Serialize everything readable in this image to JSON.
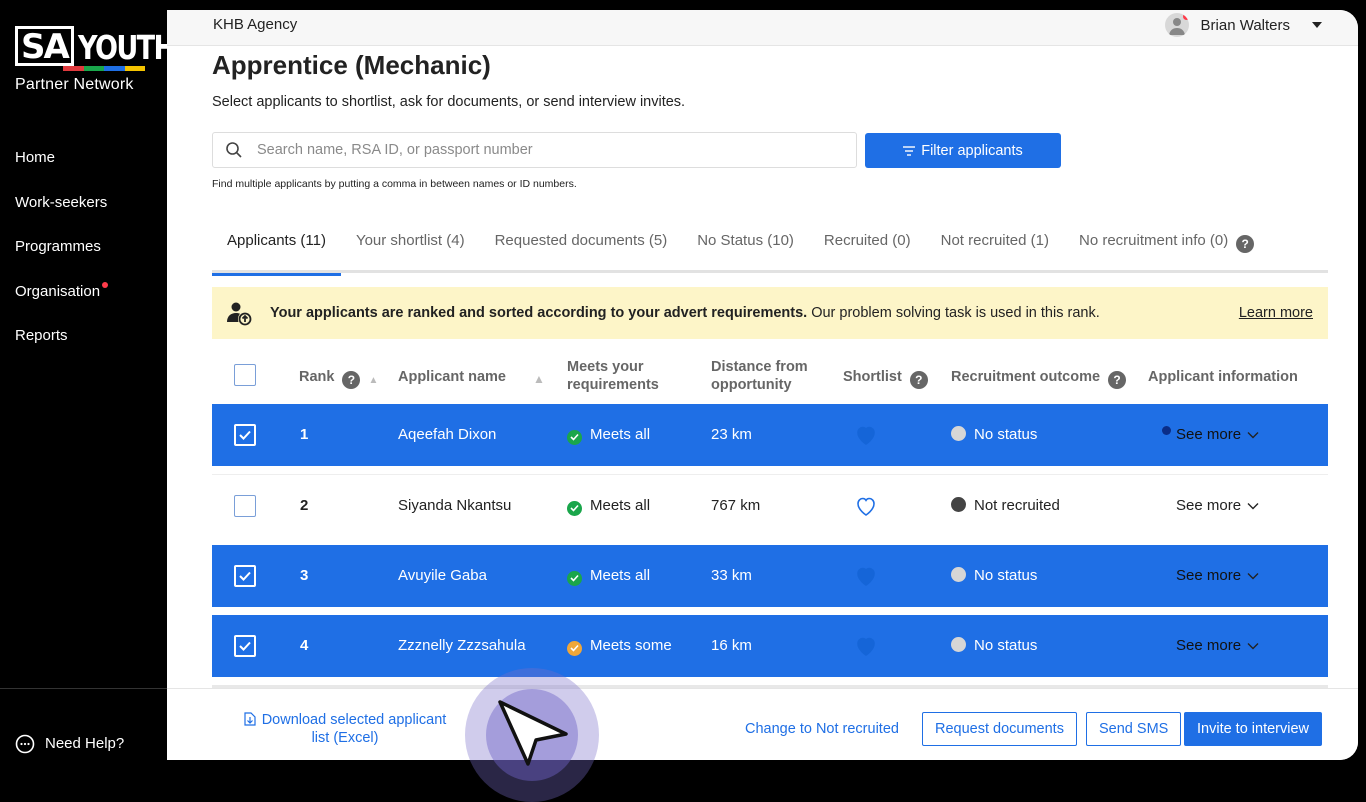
{
  "brand": {
    "logo_left": "SA",
    "logo_right": "YOUTH",
    "tagline": "Partner Network",
    "stripe_colors": [
      "#e03a3e",
      "#1aa64b",
      "#1f6fe5",
      "#f5c400"
    ]
  },
  "sidebar": {
    "items": [
      {
        "label": "Home"
      },
      {
        "label": "Work-seekers"
      },
      {
        "label": "Programmes"
      },
      {
        "label": "Organisation",
        "notification": true
      },
      {
        "label": "Reports"
      }
    ],
    "help_label": "Need Help?"
  },
  "topbar": {
    "agency": "KHB Agency",
    "user_name": "Brian Walters"
  },
  "page": {
    "title": "Apprentice (Mechanic)",
    "subtitle": "Select applicants to shortlist, ask for documents, or send interview invites.",
    "search_placeholder": "Search name, RSA ID, or passport number",
    "filter_label": "Filter applicants",
    "search_hint": "Find multiple applicants by putting a comma in between names or ID numbers."
  },
  "tabs": [
    {
      "label": "Applicants (11)",
      "active": true
    },
    {
      "label": "Your shortlist (4)"
    },
    {
      "label": "Requested documents (5)"
    },
    {
      "label": "No Status (10)"
    },
    {
      "label": "Recruited (0)"
    },
    {
      "label": "Not recruited (1)"
    },
    {
      "label": "No recruitment info (0)",
      "has_help": true
    }
  ],
  "banner": {
    "bold": "Your applicants are ranked and sorted according to your advert requirements.",
    "text": " Our problem solving task is used in this rank.",
    "link": "Learn more"
  },
  "table": {
    "headers": {
      "rank": "Rank",
      "name": "Applicant name",
      "meets_1": "Meets your",
      "meets_2": "requirements",
      "distance_1": "Distance from",
      "distance_2": "opportunity",
      "shortlist": "Shortlist",
      "outcome": "Recruitment outcome",
      "info": "Applicant information"
    },
    "rows": [
      {
        "rank": "1",
        "name": "Aqeefah Dixon",
        "meets": "Meets all",
        "meets_level": "all",
        "distance": "23 km",
        "shortlisted": true,
        "outcome": "No status",
        "selected": true,
        "see_more": "See more",
        "unread": true
      },
      {
        "rank": "2",
        "name": "Siyanda Nkantsu",
        "meets": "Meets all",
        "meets_level": "all",
        "distance": "767 km",
        "shortlisted": false,
        "outcome": "Not recruited",
        "selected": false,
        "see_more": "See more",
        "unread": false
      },
      {
        "rank": "3",
        "name": "Avuyile Gaba",
        "meets": "Meets all",
        "meets_level": "all",
        "distance": "33 km",
        "shortlisted": true,
        "outcome": "No status",
        "selected": true,
        "see_more": "See more",
        "unread": false
      },
      {
        "rank": "4",
        "name": "Zzznelly Zzzsahula",
        "meets": "Meets some",
        "meets_level": "some",
        "distance": "16 km",
        "shortlisted": true,
        "outcome": "No status",
        "selected": true,
        "see_more": "See more",
        "unread": false
      }
    ]
  },
  "footer": {
    "download": "Download selected applicant list (Excel)",
    "not_recruited": "Change to Not recruited",
    "request_docs": "Request documents",
    "send_sms": "Send SMS",
    "invite": "Invite to interview"
  },
  "colors": {
    "accent": "#1f6fe5",
    "meets_all": "#1aa64b",
    "meets_some": "#f0a73a",
    "banner_bg": "#fdf5c8"
  }
}
